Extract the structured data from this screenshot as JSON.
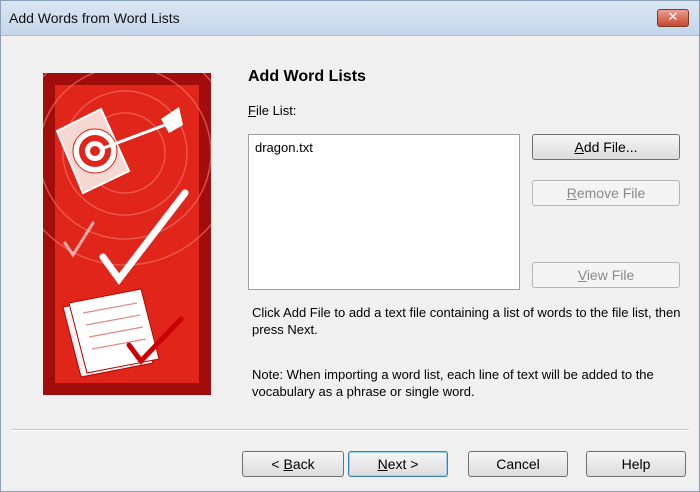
{
  "window": {
    "title": "Add Words from Word Lists",
    "close_glyph": "✕"
  },
  "page": {
    "heading": "Add Word Lists",
    "file_list_label_mnemonic": "F",
    "file_list_label_rest": "ile List:",
    "files": [
      "dragon.txt"
    ]
  },
  "buttons": {
    "add_file": {
      "mnemonic": "A",
      "rest": "dd File..."
    },
    "remove_file": {
      "mnemonic": "R",
      "rest": "emove File"
    },
    "view_file": {
      "mnemonic": "V",
      "rest": "iew File"
    },
    "back": {
      "prefix": "< ",
      "mnemonic": "B",
      "rest": "ack"
    },
    "next": {
      "mnemonic": "N",
      "rest": "ext >"
    },
    "cancel": "Cancel",
    "help": "Help"
  },
  "text": {
    "instructions": "Click Add File to add a text file containing a list of words to the file list, then press Next.",
    "note": "Note: When importing a word list, each line of text will be added to the vocabulary as a phrase or single word."
  },
  "colors": {
    "banner_red": "#e0261b",
    "banner_dark": "#a10d0a",
    "default_button_border": "#3c7fb1"
  },
  "icons": [
    "close-icon",
    "target-icon",
    "dart-icon",
    "checkmark-icon",
    "documents-icon"
  ]
}
